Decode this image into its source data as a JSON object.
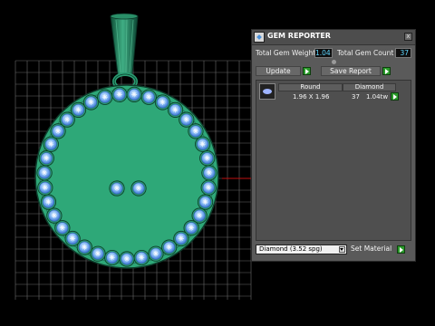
{
  "panel": {
    "title": "GEM REPORTER",
    "close_label": "x",
    "total_gem_weight_label": "Total Gem Weight",
    "total_gem_weight_value": "1.04",
    "total_gem_count_label": "Total Gem Count",
    "total_gem_count_value": "37",
    "update_label": "Update",
    "save_report_label": "Save Report",
    "table": {
      "headers": [
        "Round",
        "Diamond"
      ],
      "row": {
        "size": "1.96 X 1.96",
        "count": "37",
        "weight": "1.04tw"
      }
    },
    "material_select_value": "Diamond     (3.52 spg)",
    "set_material_label": "Set Material"
  },
  "colors": {
    "gem_green": "#2ea878",
    "bail_green": "#23805c",
    "stone_blue": "#4f8fe6",
    "accent_green": "#2a9a2a",
    "value_cyan": "#5fd6ff"
  }
}
